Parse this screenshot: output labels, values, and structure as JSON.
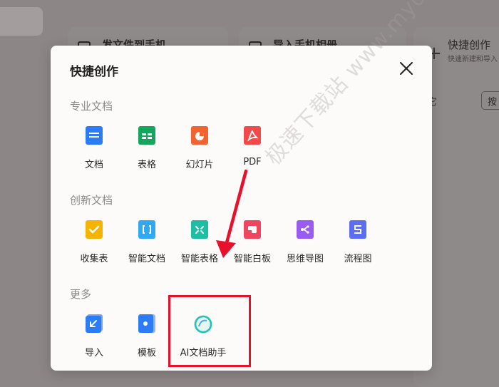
{
  "background": {
    "card1_text": "发文件到手机",
    "card2_text": "导入手机相册",
    "right_title": "快捷创作",
    "right_sub": "快速新建和导入",
    "right_chip": "按",
    "right_letter": "它"
  },
  "modal": {
    "title": "快捷创作",
    "sections": [
      {
        "label": "专业文档"
      },
      {
        "label": "创新文档"
      },
      {
        "label": "更多"
      }
    ],
    "professional": [
      {
        "label": "文档"
      },
      {
        "label": "表格"
      },
      {
        "label": "幻灯片"
      },
      {
        "label": "PDF"
      }
    ],
    "innovative": [
      {
        "label": "收集表"
      },
      {
        "label": "智能文档"
      },
      {
        "label": "智能表格"
      },
      {
        "label": "智能白板"
      },
      {
        "label": "思维导图"
      },
      {
        "label": "流程图"
      }
    ],
    "more": [
      {
        "label": "导入"
      },
      {
        "label": "模板"
      },
      {
        "label": "AI文档助手"
      }
    ]
  },
  "watermark": "极速下载站 www.mydown.com",
  "colors": {
    "highlight": "#e8112d",
    "doc_blue": "#2b7cf6",
    "sheet_green": "#16a55c",
    "slide_orange": "#f2642f",
    "pdf_red": "#f04a4a"
  }
}
